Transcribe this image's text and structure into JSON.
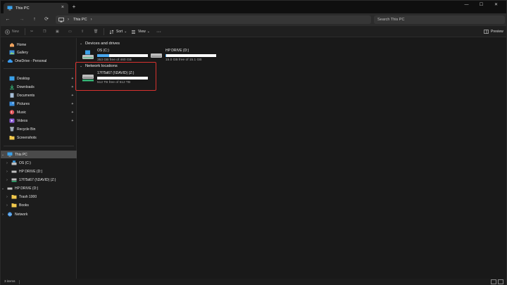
{
  "tab": {
    "title": "This PC"
  },
  "address": {
    "location": "This PC"
  },
  "search": {
    "placeholder": "Search This PC"
  },
  "command_bar": {
    "new_label": "New",
    "sort_label": "Sort",
    "view_label": "View",
    "preview_label": "Preview"
  },
  "sidebar": {
    "quick": [
      {
        "label": "Home",
        "icon": "home-icon"
      },
      {
        "label": "Gallery",
        "icon": "gallery-icon"
      },
      {
        "label": "OneDrive - Personal",
        "icon": "cloud-icon"
      }
    ],
    "pinned": [
      {
        "label": "Desktop",
        "icon": "desktop-icon"
      },
      {
        "label": "Downloads",
        "icon": "download-icon"
      },
      {
        "label": "Documents",
        "icon": "document-icon"
      },
      {
        "label": "Pictures",
        "icon": "pictures-icon"
      },
      {
        "label": "Music",
        "icon": "music-icon"
      },
      {
        "label": "Videos",
        "icon": "videos-icon"
      },
      {
        "label": "Recycle Bin",
        "icon": "recycle-bin-icon"
      },
      {
        "label": "Screenshots",
        "icon": "folder-icon"
      }
    ],
    "tree": [
      {
        "label": "This PC",
        "icon": "pc-icon"
      },
      {
        "label": "OS (C:)",
        "icon": "windows-drive-icon"
      },
      {
        "label": "HP DRIVE (D:)",
        "icon": "drive-icon"
      },
      {
        "label": "17f75d67 (\\\\DAVID) (Z:)",
        "icon": "network-drive-icon"
      },
      {
        "label": "HP DRIVE (D:)",
        "icon": "drive-icon"
      },
      {
        "label": "Trash 1000",
        "icon": "folder-icon"
      },
      {
        "label": "Books",
        "icon": "folder-icon"
      },
      {
        "label": "Network",
        "icon": "network-icon"
      }
    ]
  },
  "content": {
    "devices_header": "Devices and drives",
    "network_header": "Network locations",
    "devices": [
      {
        "name": "OS (C:)",
        "free_text": "353 GB free of 460 GB",
        "used_fraction": 0.23,
        "icon": "windows-drive-icon"
      },
      {
        "name": "HP DRIVE (D:)",
        "free_text": "15.0 GB free of 15.1 GB",
        "used_fraction": 0.01,
        "icon": "drive-icon"
      }
    ],
    "network": [
      {
        "name": "17f75d67 (\\\\DAVID) (Z:)",
        "free_text": "512 TB free of 512 TB",
        "used_fraction": 0.0,
        "icon": "network-drive-icon"
      }
    ]
  },
  "status": {
    "items_text": "3 items"
  },
  "colors": {
    "accent": "#4aa7ee",
    "highlight": "#d7322f"
  }
}
